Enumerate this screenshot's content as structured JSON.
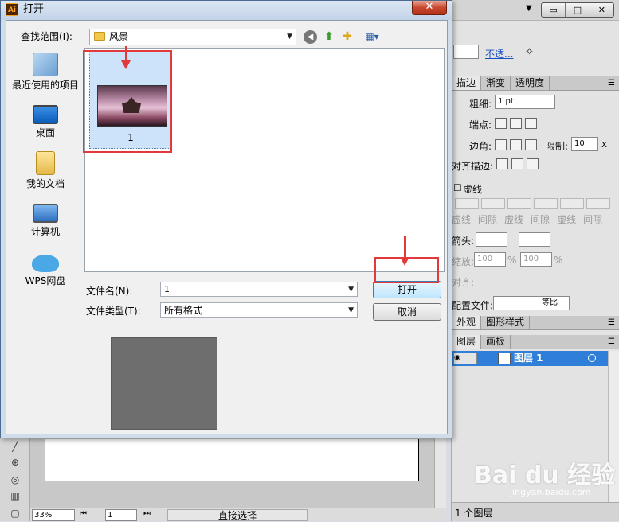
{
  "dialog": {
    "title": "打开",
    "close_glyph": "✕",
    "lookin_label": "查找范围(I):",
    "lookin_value": "风景",
    "places": [
      {
        "label": "最近使用的项目"
      },
      {
        "label": "桌面"
      },
      {
        "label": "我的文档"
      },
      {
        "label": "计算机"
      },
      {
        "label": "WPS网盘"
      }
    ],
    "files": [
      {
        "name": "1"
      }
    ],
    "filename_label": "文件名(N):",
    "filename_value": "1",
    "filetype_label": "文件类型(T):",
    "filetype_value": "所有格式",
    "open_button": "打开",
    "cancel_button": "取消",
    "dropdown_glyph": "▼"
  },
  "app": {
    "window_controls": [
      "▭",
      "□",
      "✕"
    ],
    "opacity_link": "不透...",
    "stroke_panel": {
      "tabs": [
        "描边",
        "渐变",
        "透明度"
      ],
      "weight_label": "粗细:",
      "weight_value": "1 pt",
      "cap_label": "端点:",
      "corner_label": "边角:",
      "limit_label": "限制:",
      "limit_value": "10",
      "limit_unit": "x",
      "align_label": "对齐描边:",
      "dashed_label": "虚线",
      "dash_labels": [
        "虚线",
        "间隙",
        "虚线",
        "间隙",
        "虚线",
        "间隙"
      ],
      "arrow_label": "箭头:",
      "scale_label": "缩放:",
      "scale_left": "100",
      "scale_right": "100",
      "percent": "%",
      "align2_label": "对齐:",
      "profile_label": "配置文件:",
      "profile_value": "等比"
    },
    "appearance_tabs": [
      "外观",
      "图形样式"
    ],
    "layers_tabs": [
      "图层",
      "画板"
    ],
    "layer_name": "图层 1",
    "layer_count": "1 个图层",
    "zoom": "33%",
    "page": "1",
    "status_tool": "直接选择"
  },
  "watermark": {
    "brand": "Bai du 经验",
    "url": "jingyan.baidu.com"
  }
}
